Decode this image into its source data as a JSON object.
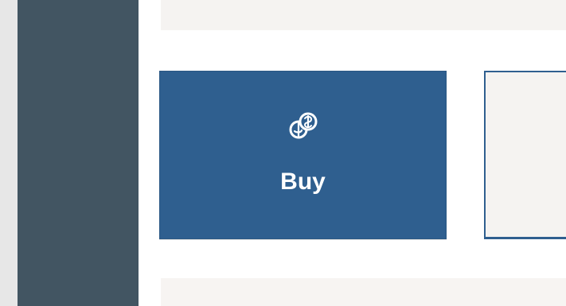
{
  "actions": [
    {
      "label": "Buy",
      "icon": "coins-icon"
    }
  ],
  "colors": {
    "sidebar": "#425562",
    "primary_tile": "#2f5f8f",
    "background": "#ffffff",
    "light_panel": "#f5f3f1"
  }
}
